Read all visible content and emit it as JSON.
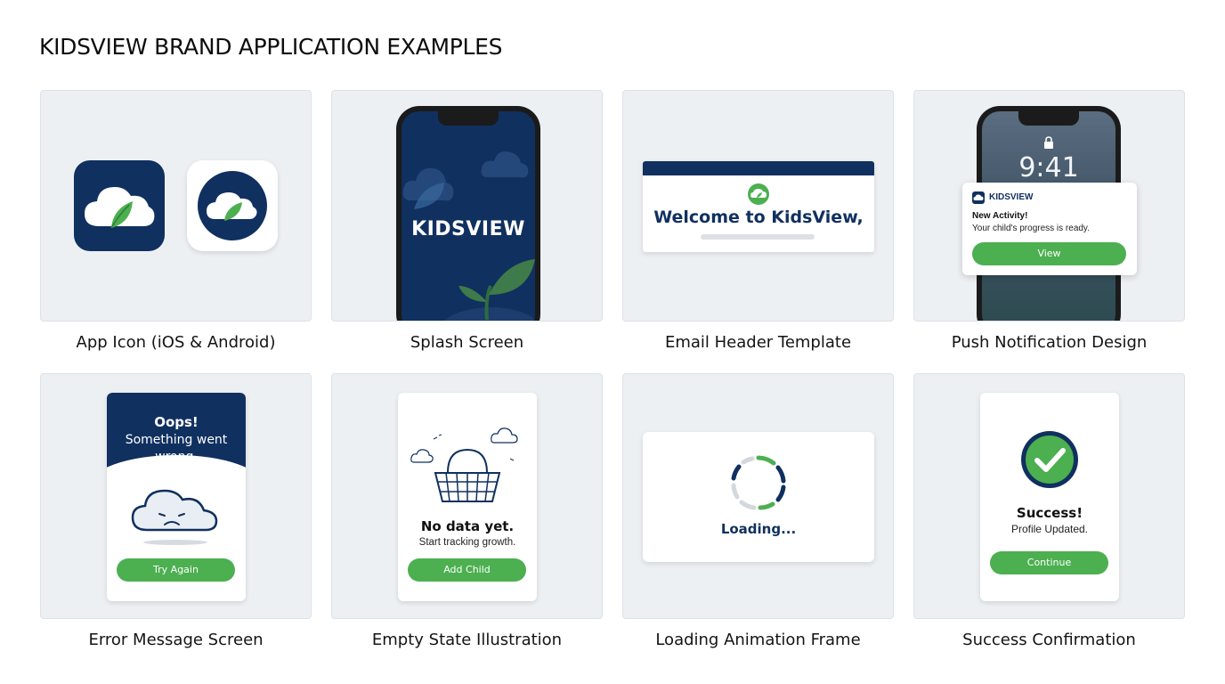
{
  "page": {
    "title": "KIDSVIEW BRAND APPLICATION EXAMPLES"
  },
  "colors": {
    "navy": "#10305f",
    "green": "#4caf50",
    "tile_bg": "#edf0f3"
  },
  "tiles": [
    {
      "caption": "App Icon (iOS & Android)",
      "icons": [
        "cloud-leaf-icon",
        "cloud-leaf-icon"
      ]
    },
    {
      "caption": "Splash Screen",
      "wordmark": "KIDSVIEW"
    },
    {
      "caption": "Email Header Template",
      "headline": "Welcome to KidsView,"
    },
    {
      "caption": "Push Notification Design",
      "time": "9:41",
      "brand": "KIDSVIEW",
      "title": "New Activity!",
      "body": "Your child's progress is ready.",
      "button": "View"
    },
    {
      "caption": "Error Message Screen",
      "headline": "Oops!",
      "body_lines": [
        "Something went",
        "wrong."
      ],
      "button": "Try Again"
    },
    {
      "caption": "Empty State Illustration",
      "headline": "No data yet.",
      "body": "Start tracking growth.",
      "button": "Add Child"
    },
    {
      "caption": "Loading Animation Frame",
      "text": "Loading..."
    },
    {
      "caption": "Success Confirmation",
      "headline": "Success!",
      "body": "Profile Updated.",
      "button": "Continue"
    }
  ]
}
